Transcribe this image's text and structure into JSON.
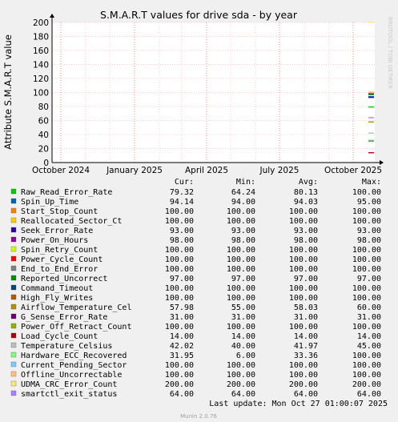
{
  "chart_data": {
    "type": "line",
    "title": "S.M.A.R.T values for drive sda - by year",
    "ylabel": "Attribute S.M.A.R.T value",
    "watermark": "RRDTOOL / TOBI OETIKER",
    "ylim": [
      0,
      200
    ],
    "ytick_values": [
      0,
      20,
      40,
      60,
      80,
      100,
      120,
      140,
      160,
      180,
      200
    ],
    "ytick_labels": [
      "0",
      "20",
      "40",
      "60",
      "80",
      "100",
      "120",
      "140",
      "160",
      "180",
      "200"
    ],
    "xlim": [
      "2024-09-20",
      "2025-10-28"
    ],
    "xtick_dates": [
      "2024-10-01",
      "2025-01-01",
      "2025-04-01",
      "2025-07-01",
      "2025-10-01"
    ],
    "xtick_labels": [
      "October 2024",
      "January 2025",
      "April 2025",
      "July 2025",
      "October 2025"
    ],
    "data_start": "2025-10-20",
    "data_end": "2025-10-27",
    "grid": true,
    "legend_header": {
      "cur": "Cur:",
      "min": "Min:",
      "avg": "Avg:",
      "max": "Max:"
    },
    "series": [
      {
        "name": "Raw_Read_Error_Rate",
        "color": "#00cc00",
        "cur": "79.32",
        "min": "64.24",
        "avg": "80.13",
        "max": "100.00"
      },
      {
        "name": "Spin_Up_Time",
        "color": "#0066b3",
        "cur": "94.14",
        "min": "94.00",
        "avg": "94.03",
        "max": "95.00"
      },
      {
        "name": "Start_Stop_Count",
        "color": "#ff8000",
        "cur": "100.00",
        "min": "100.00",
        "avg": "100.00",
        "max": "100.00"
      },
      {
        "name": "Reallocated_Sector_Ct",
        "color": "#ffcc00",
        "cur": "100.00",
        "min": "100.00",
        "avg": "100.00",
        "max": "100.00"
      },
      {
        "name": "Seek_Error_Rate",
        "color": "#330099",
        "cur": "93.00",
        "min": "93.00",
        "avg": "93.00",
        "max": "93.00"
      },
      {
        "name": "Power_On_Hours",
        "color": "#990099",
        "cur": "98.00",
        "min": "98.00",
        "avg": "98.00",
        "max": "98.00"
      },
      {
        "name": "Spin_Retry_Count",
        "color": "#ccff00",
        "cur": "100.00",
        "min": "100.00",
        "avg": "100.00",
        "max": "100.00"
      },
      {
        "name": "Power_Cycle_Count",
        "color": "#ff0000",
        "cur": "100.00",
        "min": "100.00",
        "avg": "100.00",
        "max": "100.00"
      },
      {
        "name": "End_to_End_Error",
        "color": "#808080",
        "cur": "100.00",
        "min": "100.00",
        "avg": "100.00",
        "max": "100.00"
      },
      {
        "name": "Reported_Uncorrect",
        "color": "#008f00",
        "cur": "97.00",
        "min": "97.00",
        "avg": "97.00",
        "max": "97.00"
      },
      {
        "name": "Command_Timeout",
        "color": "#00487d",
        "cur": "100.00",
        "min": "100.00",
        "avg": "100.00",
        "max": "100.00"
      },
      {
        "name": "High_Fly_Writes",
        "color": "#b35a00",
        "cur": "100.00",
        "min": "100.00",
        "avg": "100.00",
        "max": "100.00"
      },
      {
        "name": "Airflow_Temperature_Cel",
        "color": "#b38f00",
        "cur": "57.98",
        "min": "55.00",
        "avg": "58.03",
        "max": "60.00"
      },
      {
        "name": "G_Sense_Error_Rate",
        "color": "#6b006b",
        "cur": "31.00",
        "min": "31.00",
        "avg": "31.00",
        "max": "31.00"
      },
      {
        "name": "Power_Off_Retract_Count",
        "color": "#8fb300",
        "cur": "100.00",
        "min": "100.00",
        "avg": "100.00",
        "max": "100.00"
      },
      {
        "name": "Load_Cycle_Count",
        "color": "#b30000",
        "cur": "14.00",
        "min": "14.00",
        "avg": "14.00",
        "max": "14.00"
      },
      {
        "name": "Temperature_Celsius",
        "color": "#bebebe",
        "cur": "42.02",
        "min": "40.00",
        "avg": "41.97",
        "max": "45.00"
      },
      {
        "name": "Hardware_ECC_Recovered",
        "color": "#80ff80",
        "cur": "31.95",
        "min": "6.00",
        "avg": "33.36",
        "max": "100.00"
      },
      {
        "name": "Current_Pending_Sector",
        "color": "#80c9ff",
        "cur": "100.00",
        "min": "100.00",
        "avg": "100.00",
        "max": "100.00"
      },
      {
        "name": "Offline_Uncorrectable",
        "color": "#ffc080",
        "cur": "100.00",
        "min": "100.00",
        "avg": "100.00",
        "max": "100.00"
      },
      {
        "name": "UDMA_CRC_Error_Count",
        "color": "#ffe680",
        "cur": "200.00",
        "min": "200.00",
        "avg": "200.00",
        "max": "200.00"
      },
      {
        "name": "smartctl_exit_status",
        "color": "#aa80ff",
        "cur": "64.00",
        "min": "64.00",
        "avg": "64.00",
        "max": "64.00"
      }
    ],
    "last_update": "Last update: Mon Oct 27 01:00:07 2025",
    "footer": "Munin 2.0.76"
  },
  "colors": {
    "background": "#f0f0f0",
    "plot_background": "#ffffff",
    "grid": "#ff9999",
    "axis": "#000000",
    "text": "#000000",
    "footer_text": "#a0a0a0"
  }
}
